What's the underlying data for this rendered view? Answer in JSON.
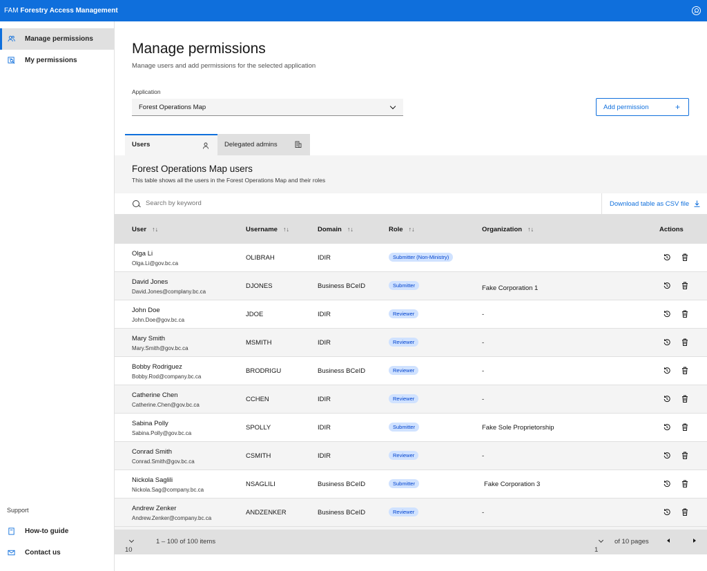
{
  "header": {
    "brand_short": "FAM",
    "brand_name": "Forestry Access Management"
  },
  "sidebar": {
    "items": [
      {
        "label": "Manage permissions",
        "icon": "users-icon",
        "active": true
      },
      {
        "label": "My permissions",
        "icon": "id-search-icon",
        "active": false
      }
    ],
    "support_label": "Support",
    "support_items": [
      {
        "label": "How-to guide",
        "icon": "book-icon"
      },
      {
        "label": "Contact us",
        "icon": "email-icon"
      }
    ]
  },
  "page": {
    "title": "Manage permissions",
    "subtitle": "Manage users and add permissions for the selected application",
    "application_label": "Application",
    "application_value": "Forest Operations Map",
    "add_button": "Add permission",
    "add_button_icon": "+"
  },
  "tabs": [
    {
      "label": "Users",
      "icon": "user-icon",
      "active": true
    },
    {
      "label": "Delegated admins",
      "icon": "building-icon",
      "active": false
    }
  ],
  "table": {
    "title": "Forest Operations Map users",
    "subtitle": "This table shows all the users in the Forest Operations Map and their roles",
    "search_placeholder": "Search by keyword",
    "download_label": "Download table as CSV file",
    "columns": [
      "User",
      "Username",
      "Domain",
      "Role",
      "Organization",
      "Actions"
    ],
    "sort_glyph": "↑↓",
    "rows": [
      {
        "name": "Olga Li",
        "email": "Olga.Li@gov.bc.ca",
        "username": "OLIBRAH",
        "domain": "IDIR",
        "role": "Submitter (Non-Ministry)",
        "organization": ""
      },
      {
        "name": "David Jones",
        "email": "David.Jones@complany.bc.ca",
        "username": "DJONES",
        "domain": "Business BCeID",
        "role": "Submitter",
        "organization": "Fake Corporation 1"
      },
      {
        "name": "John Doe",
        "email": "John.Doe@gov.bc.ca",
        "username": "JDOE",
        "domain": "IDIR",
        "role": "Reviewer",
        "organization": "-"
      },
      {
        "name": "Mary Smith",
        "email": "Mary.Smith@gov.bc.ca",
        "username": "MSMITH",
        "domain": "IDIR",
        "role": "Reviewer",
        "organization": "-"
      },
      {
        "name": "Bobby Rodriguez",
        "email": "Bobby.Rod@company.bc.ca",
        "username": "BRODRIGU",
        "domain": "Business BCeID",
        "role": "Reviewer",
        "organization": "-"
      },
      {
        "name": "Catherine Chen",
        "email": "Catherine.Chen@gov.bc.ca",
        "username": "CCHEN",
        "domain": "IDIR",
        "role": "Reviewer",
        "organization": "-"
      },
      {
        "name": "Sabina Polly",
        "email": "Sabina.Polly@gov.bc.ca",
        "username": "SPOLLY",
        "domain": "IDIR",
        "role": "Submitter",
        "organization": "Fake Sole Proprietorship"
      },
      {
        "name": "Conrad Smith",
        "email": "Conrad.Smith@gov.bc.ca",
        "username": "CSMITH",
        "domain": "IDIR",
        "role": "Reviewer",
        "organization": "-"
      },
      {
        "name": "Nickola Saglili",
        "email": "Nickola.Sag@company.bc.ca",
        "username": "NSAGLILI",
        "domain": "Business BCeID",
        "role": "Submitter",
        "organization": "Fake Corporation 3"
      },
      {
        "name": "Andrew Zenker",
        "email": "Andrew.Zenker@company.bc.ca",
        "username": "ANDZENKER",
        "domain": "Business BCeID",
        "role": "Reviewer",
        "organization": "-"
      }
    ]
  },
  "pagination": {
    "page_size": "10",
    "range_text": "1 – 100 of 100 items",
    "current_page": "1",
    "pages_text": "of 10 pages"
  },
  "colors": {
    "accent": "#0f6fdc",
    "badge_bg": "#d0e2ff",
    "badge_text": "#0043ce"
  }
}
